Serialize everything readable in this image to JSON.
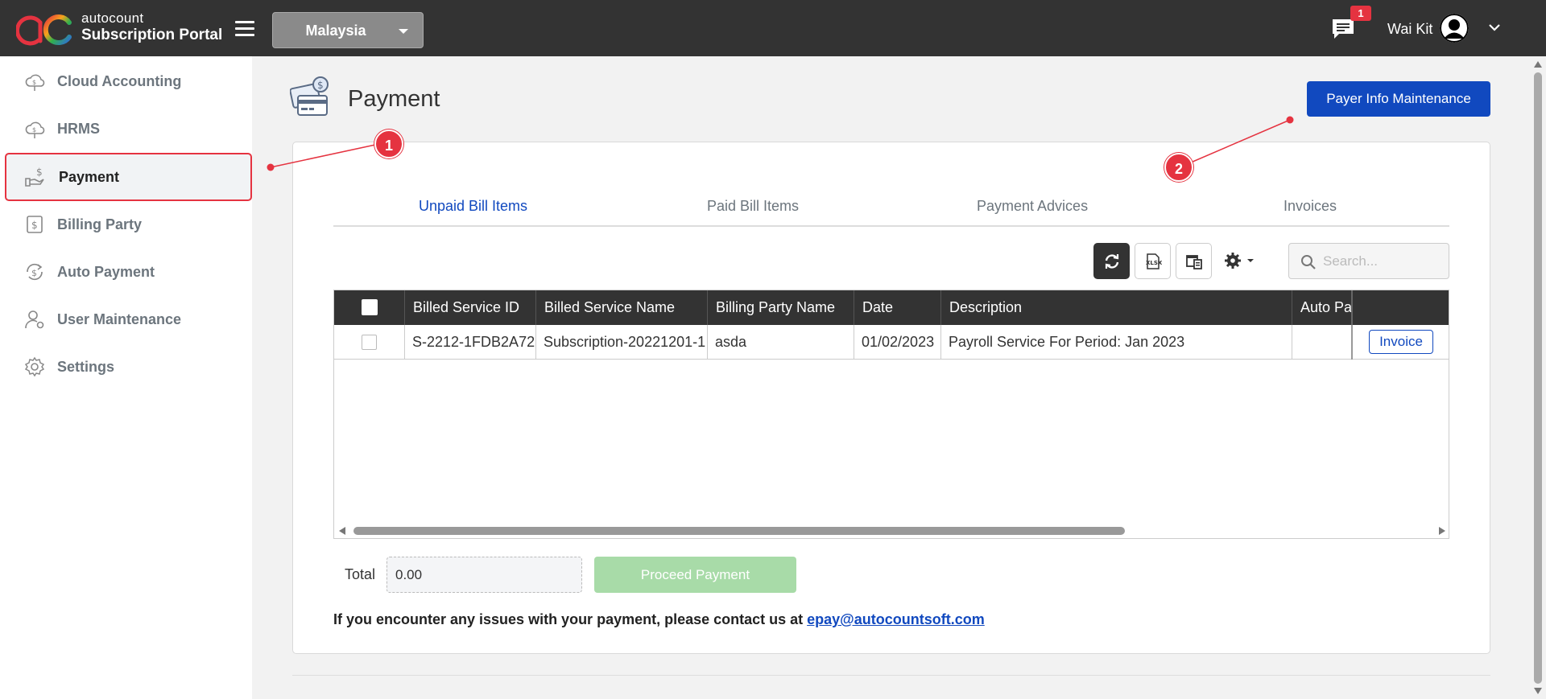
{
  "header": {
    "brand_line1": "autocount",
    "brand_line2": "Subscription Portal",
    "country_select": "Malaysia",
    "notification_count": "1",
    "user_name": "Wai Kit"
  },
  "sidebar": {
    "items": [
      {
        "label": "Cloud Accounting",
        "icon": "cloud-accounting-icon"
      },
      {
        "label": "HRMS",
        "icon": "hrms-icon"
      },
      {
        "label": "Payment",
        "icon": "payment-hand-icon",
        "active": true
      },
      {
        "label": "Billing Party",
        "icon": "billing-party-icon"
      },
      {
        "label": "Auto Payment",
        "icon": "auto-payment-icon"
      },
      {
        "label": "User Maintenance",
        "icon": "user-icon"
      },
      {
        "label": "Settings",
        "icon": "gear-icon"
      }
    ]
  },
  "page": {
    "title": "Payment",
    "payer_button": "Payer Info Maintenance"
  },
  "tabs": [
    {
      "label": "Unpaid Bill Items",
      "active": true
    },
    {
      "label": "Paid Bill Items"
    },
    {
      "label": "Payment Advices"
    },
    {
      "label": "Invoices"
    }
  ],
  "search": {
    "placeholder": "Search..."
  },
  "table": {
    "columns": [
      "",
      "Billed Service ID",
      "Billed Service Name",
      "Billing Party Name",
      "Date",
      "Description",
      "Auto Pay",
      ""
    ],
    "rows": [
      {
        "billed_service_id": "S-2212-1FDB2A72",
        "billed_service_name": "Subscription-20221201-1",
        "billing_party_name": "asda",
        "date": "01/02/2023",
        "description": "Payroll Service For Period: Jan 2023",
        "auto_pay": "",
        "action": "Invoice"
      }
    ]
  },
  "footer": {
    "total_label": "Total",
    "total_value": "0.00",
    "proceed_button": "Proceed Payment",
    "contact_text": "If you encounter any issues with your payment, please contact us at ",
    "contact_email": "epay@autocountsoft.com"
  },
  "annotations": {
    "marker1": "1",
    "marker2": "2"
  },
  "colors": {
    "topbar": "#333333",
    "primary": "#1149bf",
    "annotation": "#e53340",
    "proceed_disabled": "#a8dba8"
  }
}
